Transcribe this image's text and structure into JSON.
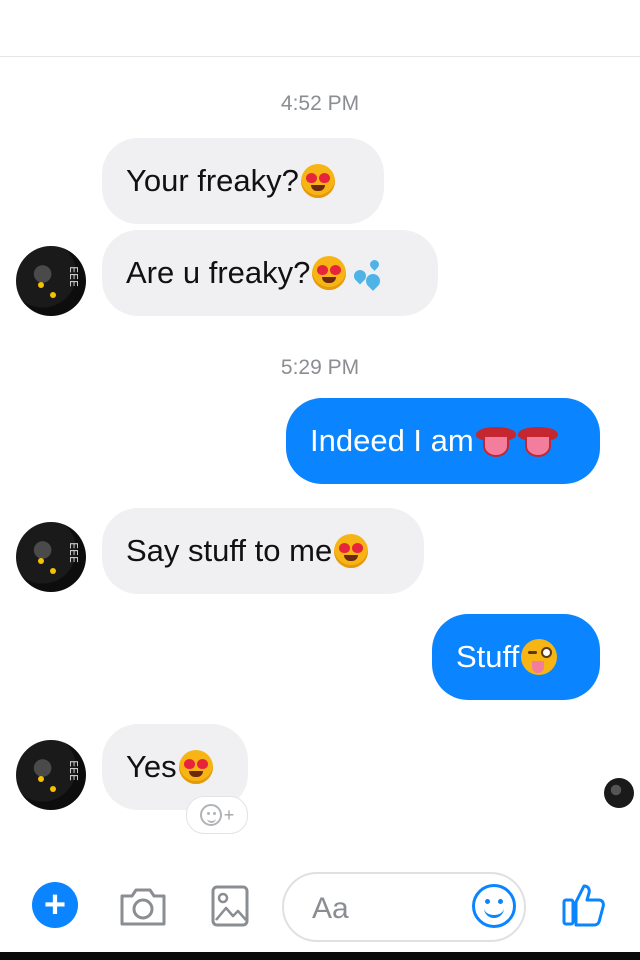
{
  "conversation": {
    "timestamps": [
      "4:52 PM",
      "5:29 PM"
    ],
    "messages": [
      {
        "from": "them",
        "text": "Your freaky?",
        "emoji": "heart-eyes"
      },
      {
        "from": "them",
        "text": "Are u freaky?",
        "emoji": "heart-eyes + sweat-droplets"
      },
      {
        "from": "me",
        "text": "Indeed I am",
        "emoji": "tongue x2"
      },
      {
        "from": "them",
        "text": "Say stuff to me",
        "emoji": "heart-eyes"
      },
      {
        "from": "me",
        "text": "Stuff",
        "emoji": "winking-tongue"
      },
      {
        "from": "them",
        "text": "Yes",
        "emoji": "heart-eyes"
      }
    ]
  },
  "reaction_button": {
    "label": "+"
  },
  "composer": {
    "add_label": "+",
    "placeholder": "Aa",
    "icons": [
      "plus-icon",
      "camera-icon",
      "image-icon",
      "emoji-icon",
      "thumbs-up-icon"
    ]
  },
  "colors": {
    "outgoing": "#0a84ff",
    "incoming": "#f0f0f2",
    "timestamp": "#8a8d91"
  }
}
